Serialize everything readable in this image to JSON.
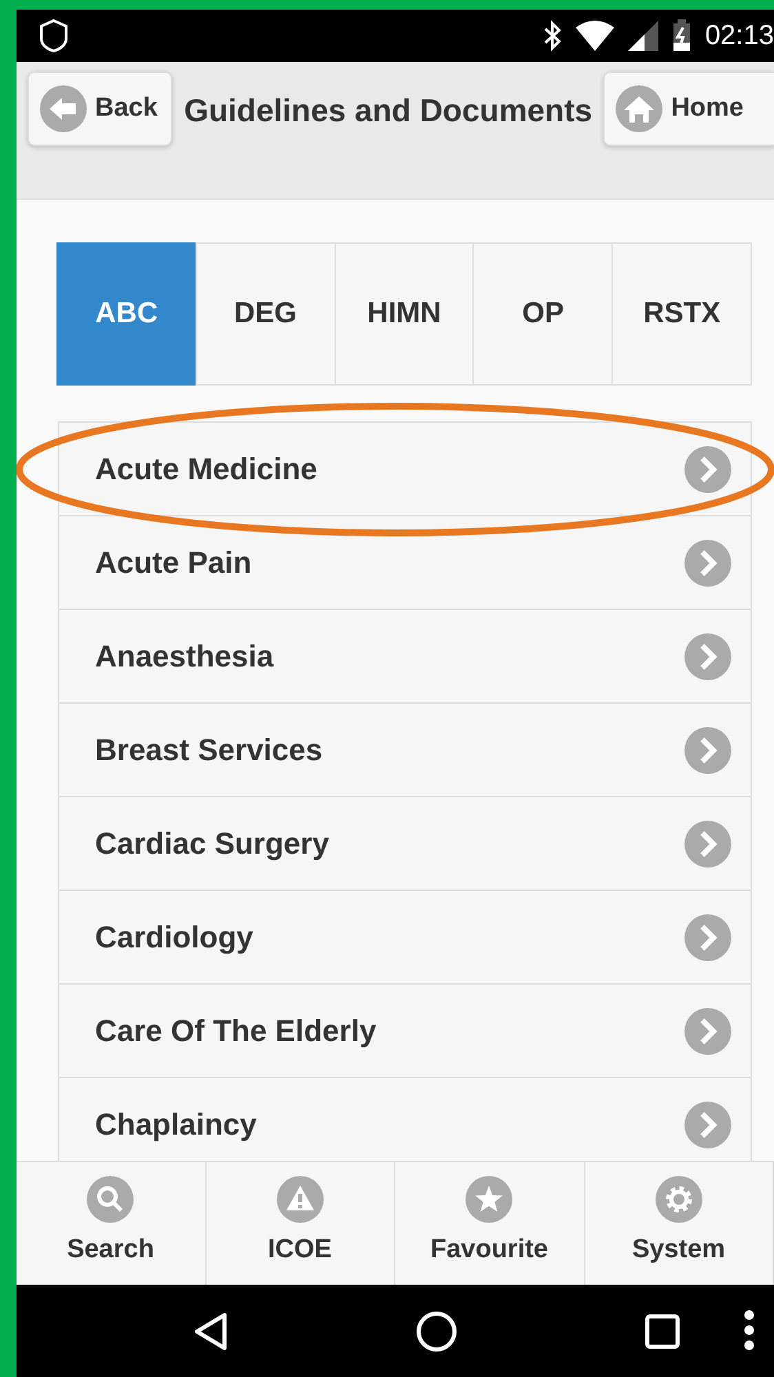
{
  "status_bar": {
    "time": "02:13"
  },
  "header": {
    "title": "Guidelines and Documents",
    "back": "Back",
    "home": "Home"
  },
  "tabs": [
    {
      "label": "ABC",
      "selected": true
    },
    {
      "label": "DEG",
      "selected": false
    },
    {
      "label": "HIMN",
      "selected": false
    },
    {
      "label": "OP",
      "selected": false
    },
    {
      "label": "RSTX",
      "selected": false
    }
  ],
  "items": [
    {
      "label": "Acute Medicine",
      "circled": true
    },
    {
      "label": "Acute Pain",
      "circled": false
    },
    {
      "label": "Anaesthesia",
      "circled": false
    },
    {
      "label": "Breast Services",
      "circled": false
    },
    {
      "label": "Cardiac Surgery",
      "circled": false
    },
    {
      "label": "Cardiology",
      "circled": false
    },
    {
      "label": "Care Of The Elderly",
      "circled": false
    },
    {
      "label": "Chaplaincy",
      "circled": false
    }
  ],
  "footer": [
    {
      "label": "Search",
      "kind": "search"
    },
    {
      "label": "ICOE",
      "kind": "warning"
    },
    {
      "label": "Favourite",
      "kind": "star"
    },
    {
      "label": "System",
      "kind": "gear"
    }
  ]
}
